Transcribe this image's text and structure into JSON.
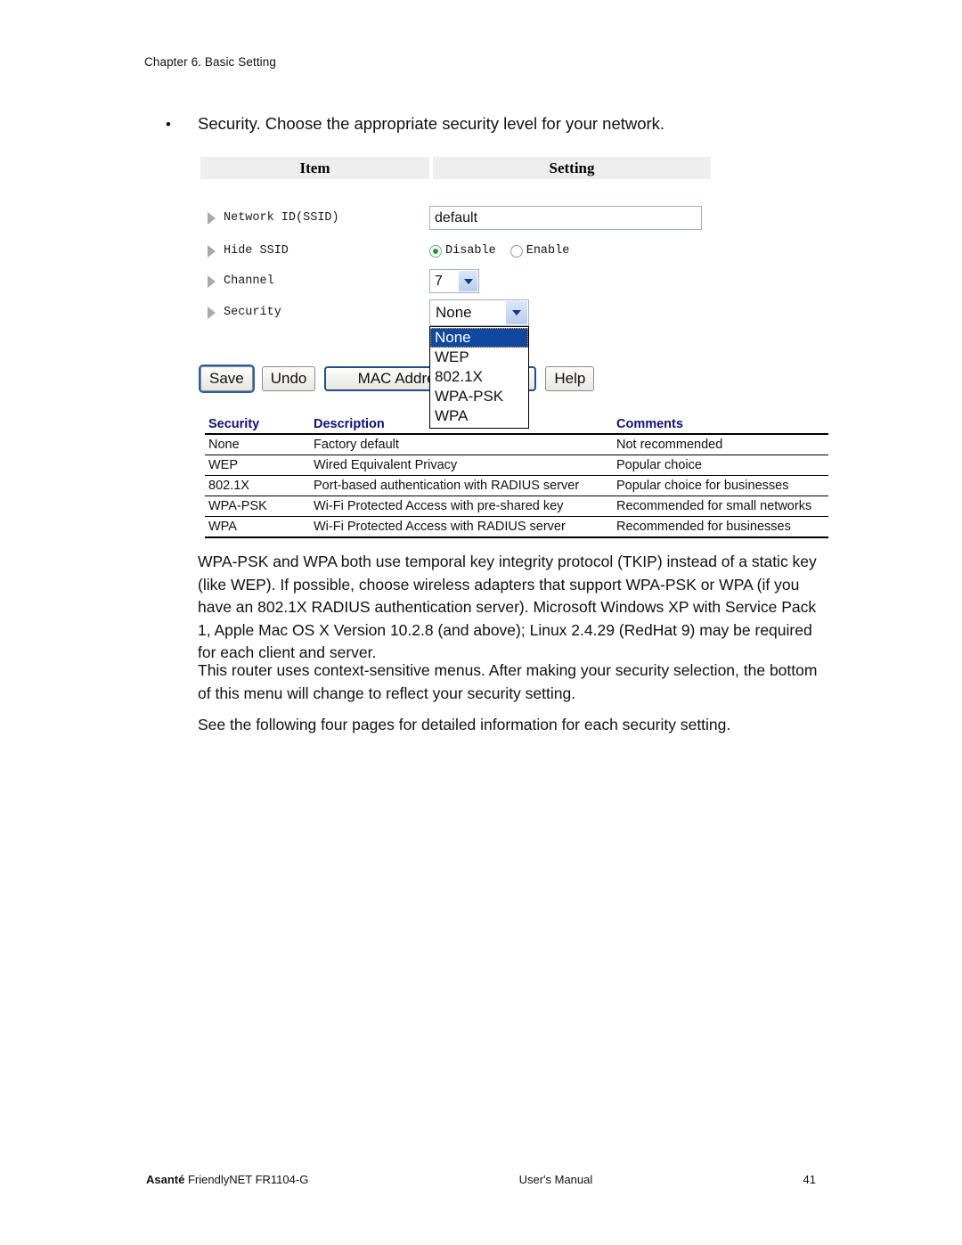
{
  "header": {
    "chapter": "Chapter 6. Basic Setting"
  },
  "bullet": {
    "marker": "•",
    "text": "Security. Choose the appropriate security level for your network."
  },
  "router_ui": {
    "columns": {
      "item": "Item",
      "setting": "Setting"
    },
    "rows": [
      {
        "label": "Network ID(SSID)",
        "control": "text",
        "value": "default"
      },
      {
        "label": "Hide SSID",
        "control": "radio",
        "options": [
          "Disable",
          "Enable"
        ],
        "selected": "Disable"
      },
      {
        "label": "Channel",
        "control": "select",
        "value": "7"
      },
      {
        "label": "Security",
        "control": "select",
        "value": "None"
      }
    ],
    "security_dropdown": {
      "selected": "None",
      "options": [
        "None",
        "WEP",
        "802.1X",
        "WPA-PSK",
        "WPA"
      ]
    },
    "buttons": [
      {
        "label": "Save",
        "style": "focused"
      },
      {
        "label": "Undo",
        "style": "normal"
      },
      {
        "label": "MAC Address Control",
        "style": "wide"
      },
      {
        "label": "Help",
        "style": "normal"
      }
    ],
    "colors": {
      "header_bg": "#eeeeee",
      "input_border": "#9bb0c9",
      "dropdown_highlight": "#1048a0",
      "radio_dot": "#21a121",
      "wide_button_border": "#1e4f8a"
    }
  },
  "comparison_table": {
    "headers": [
      "Security",
      "Description",
      "Comments"
    ],
    "header_color": "#10107a",
    "rows": [
      [
        "None",
        "Factory default",
        "Not recommended"
      ],
      [
        "WEP",
        "Wired Equivalent Privacy",
        "Popular choice"
      ],
      [
        "802.1X",
        "Port-based authentication with RADIUS server",
        "Popular choice for businesses"
      ],
      [
        "WPA-PSK",
        "Wi-Fi Protected Access with pre-shared key",
        "Recommended for small networks"
      ],
      [
        "WPA",
        "Wi-Fi Protected Access with RADIUS server",
        "Recommended for businesses"
      ]
    ]
  },
  "paragraphs": {
    "p1": "WPA-PSK and WPA both use temporal key integrity protocol (TKIP) instead of a static key (like WEP). If possible, choose wireless adapters that support WPA-PSK or WPA (if you have an 802.1X RADIUS authentication server). Microsoft Windows XP with Service Pack 1, Apple Mac OS X Version 10.2.8 (and above); Linux 2.4.29 (RedHat 9) may be required for each client and server.",
    "p2": "This router uses context-sensitive menus. After making your security selection, the bottom of this menu will change to reflect your security setting.",
    "p3": "See the following four pages for detailed information for each security setting."
  },
  "footer": {
    "product_brand": "Asanté",
    "product_model": " FriendlyNET FR1104-G",
    "center": "User's Manual",
    "page_number": "41"
  }
}
